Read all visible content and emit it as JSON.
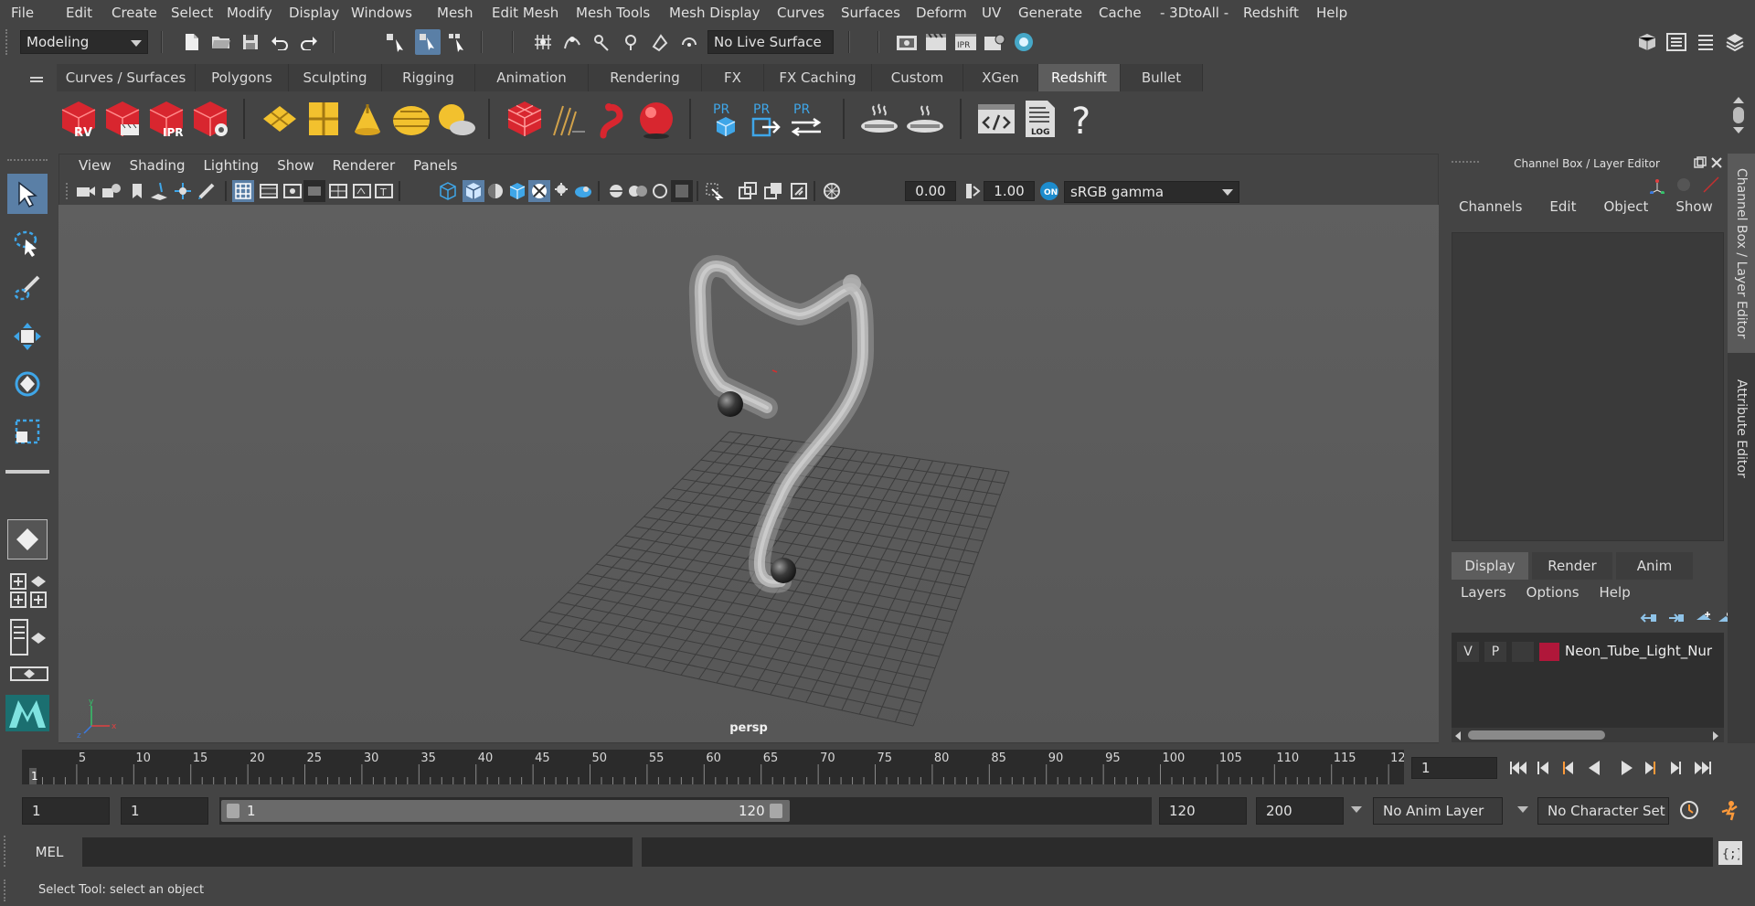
{
  "menubar": {
    "items": [
      "File",
      "Edit",
      "Create",
      "Select",
      "Modify",
      "Display",
      "Windows",
      "Mesh",
      "Edit Mesh",
      "Mesh Tools",
      "Mesh Display",
      "Curves",
      "Surfaces",
      "Deform",
      "UV",
      "Generate",
      "Cache",
      "- 3DtoAll -",
      "Redshift",
      "Help"
    ]
  },
  "statusline": {
    "mode": "Modeling",
    "live_surface": "No Live Surface"
  },
  "shelf": {
    "tabs": [
      "Curves / Surfaces",
      "Polygons",
      "Sculpting",
      "Rigging",
      "Animation",
      "Rendering",
      "FX",
      "FX Caching",
      "Custom",
      "XGen",
      "Redshift",
      "Bullet"
    ],
    "active_tab": "Redshift",
    "rv_label": "RV",
    "ipr_label": "IPR",
    "pr_label": "PR",
    "log_label": "LOG"
  },
  "viewport": {
    "menu": [
      "View",
      "Shading",
      "Lighting",
      "Show",
      "Renderer",
      "Panels"
    ],
    "exposure": "0.00",
    "gamma": "1.00",
    "color_space": "sRGB gamma",
    "camera_label": "persp"
  },
  "channel_box": {
    "title": "Channel Box / Layer Editor",
    "menu": [
      "Channels",
      "Edit",
      "Object",
      "Show"
    ],
    "layer_tabs": [
      "Display",
      "Render",
      "Anim"
    ],
    "active_layer_tab": "Display",
    "layer_menu": [
      "Layers",
      "Options",
      "Help"
    ],
    "layers": [
      {
        "v": "V",
        "p": "P",
        "color": "#b0173a",
        "name": "Neon_Tube_Light_Nur"
      }
    ]
  },
  "side_tabs": [
    "Channel Box / Layer Editor",
    "Attribute Editor"
  ],
  "timeline": {
    "ticks": [
      "5",
      "10",
      "15",
      "20",
      "25",
      "30",
      "35",
      "40",
      "45",
      "50",
      "55",
      "60",
      "65",
      "70",
      "75",
      "80",
      "85",
      "90",
      "95",
      "100",
      "105",
      "110",
      "115",
      "12"
    ],
    "current_marker": "1",
    "current_frame": "1"
  },
  "range": {
    "start": "1",
    "playback_start": "1",
    "slider_start": "1",
    "slider_end": "120",
    "playback_end": "120",
    "end": "200",
    "anim_layer": "No Anim Layer",
    "character_set": "No Character Set"
  },
  "cmdline": {
    "label": "MEL"
  },
  "helpline": {
    "text": "Select Tool: select an object"
  },
  "colors": {
    "redshift_red": "#d8262f",
    "yellow": "#f2c12e",
    "blue": "#3fa6e8",
    "active_tool": "#5a7fa6"
  }
}
